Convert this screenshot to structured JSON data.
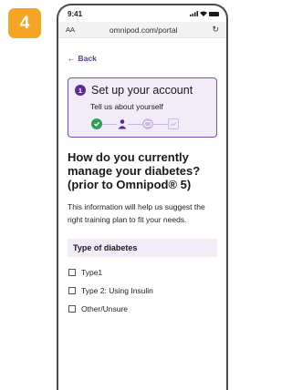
{
  "step_number": "4",
  "status_bar": {
    "time": "9:41"
  },
  "browser": {
    "text_size": "AA",
    "url": "omnipod.com/portal"
  },
  "back": {
    "label": "Back"
  },
  "setup_card": {
    "step": "1",
    "title": "Set up your account",
    "subtitle": "Tell us about yourself",
    "progress_steps": [
      "done",
      "current",
      "todo",
      "todo-last"
    ]
  },
  "question": {
    "title": "How do you currently manage your diabetes? (prior to Omnipod® 5)"
  },
  "info_text": "This information will help us suggest the right training plan to fit your needs.",
  "diabetes_type": {
    "header": "Type of diabetes",
    "options": [
      {
        "label": "Type1",
        "checked": false
      },
      {
        "label": "Type 2: Using Insulin",
        "checked": false
      },
      {
        "label": "Other/Unsure",
        "checked": false
      }
    ]
  },
  "colors": {
    "accent": "#5b2d90",
    "badge": "#f5a523",
    "success": "#2f9e58",
    "card_bg": "#f2ecf8"
  }
}
